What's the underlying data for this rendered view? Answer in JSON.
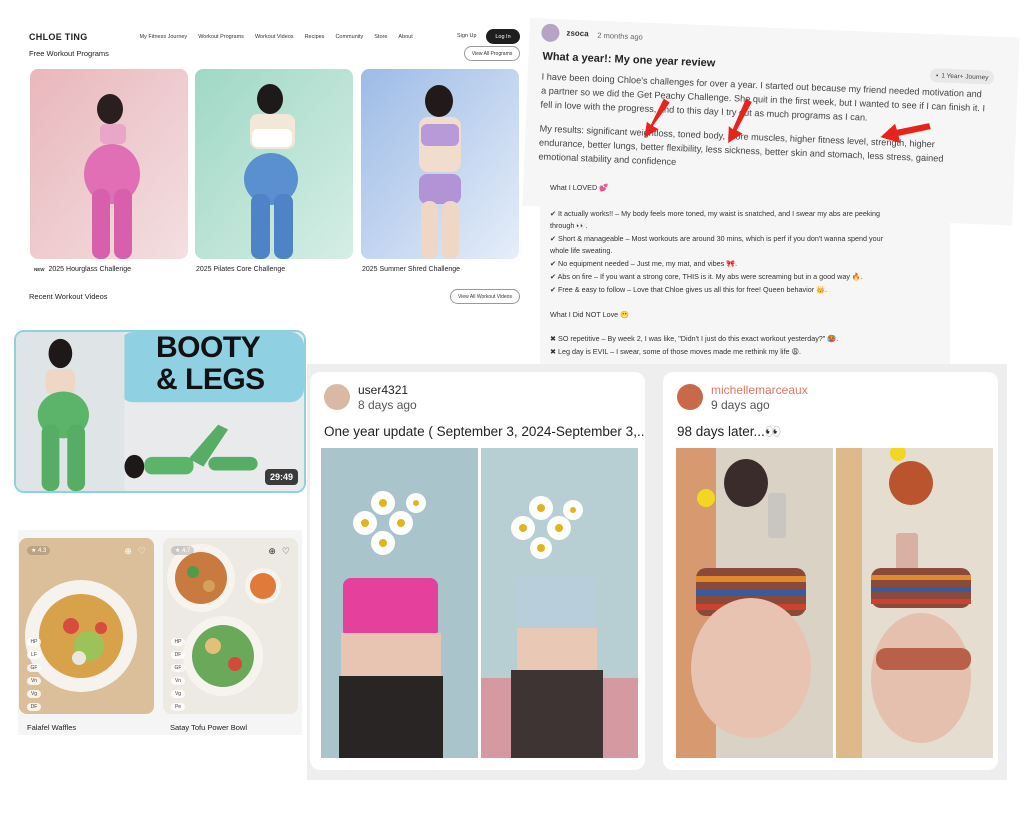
{
  "site": {
    "logo": "CHLOE TING",
    "nav": [
      "My Fitness Journey",
      "Workout Programs",
      "Workout Videos",
      "Recipes",
      "Community",
      "Store",
      "About"
    ],
    "signup": "Sign Up",
    "login": "Log In",
    "programs_title": "Free Workout Programs",
    "programs_button": "View All Programs",
    "programs": [
      {
        "new_tag": "NEW",
        "label": "2025 Hourglass Challenge"
      },
      {
        "new_tag": "",
        "label": "2025 Pilates Core Challenge"
      },
      {
        "new_tag": "",
        "label": "2025 Summer Shred Challenge"
      }
    ],
    "videos_title": "Recent Workout Videos",
    "videos_button": "View All Workout Videos"
  },
  "review": {
    "user": "zsoca",
    "time": "2 months ago",
    "title": "What a year!: My one year review",
    "badge": "1 Year+ Journey",
    "p1": [
      "I have been doing Chloe's challenges for over a year. I started out because my friend needed motivation and",
      "a partner so we did the Get Peachy Challenge. She quit in the first week, but I wanted to see if I can finish it. I",
      "fell in love with the progress, and to this day I try out as much programs as I can."
    ],
    "p2": [
      "My results: significant weightloss, toned body, more muscles, higher fitness level, strength, higher",
      "endurance, better lungs, better flexibility, less sickness, better skin and stomach, less stress, gained",
      "emotional stability and confidence"
    ],
    "loved_title": "What I LOVED 💕",
    "loved": [
      "✔ It actually works!! – My body feels more toned, my waist is snatched, and I swear my abs are peeking",
      "through 👀.",
      "✔ Short & manageable – Most workouts are around 30 mins, which is perf if you don't wanna spend your",
      "whole life sweating.",
      "✔ No equipment needed – Just me, my mat, and vibes 🎀.",
      "✔ Abs on fire – If you want a strong core, THIS is it. My abs were screaming but in a good way 🔥.",
      "✔ Free & easy to follow – Love that Chloe gives us all this for free! Queen behavior 👑."
    ],
    "not_love_title": "What I Did NOT Love 😬",
    "not_love": [
      "✖ SO repetitive – By week 2, I was like, \"Didn't I just do this exact workout yesterday?\" 🥵.",
      "✖ Leg day is EVIL – I swear, some of those moves made me rethink my life 😩."
    ]
  },
  "video": {
    "title_line1": "BOOTY",
    "title_line2": "& LEGS",
    "duration": "29:49"
  },
  "recipes": [
    {
      "rating": "4.3",
      "label": "Falafel Waffles",
      "tags": [
        "HP",
        "LF",
        "GF",
        "Vn",
        "Vg",
        "DF"
      ]
    },
    {
      "rating": "4.7",
      "label": "Satay Tofu Power Bowl",
      "tags": [
        "HP",
        "DF",
        "GF",
        "Vn",
        "Vg",
        "Pe"
      ]
    }
  ],
  "posts": [
    {
      "user": "user4321",
      "time": "8 days ago",
      "title": "One year update ( September 3, 2024-September 3,..."
    },
    {
      "user": "michellemarceaux",
      "time": "9 days ago",
      "title": "98 days later...👀"
    }
  ],
  "colors": {
    "accent_red": "#e8231b",
    "login_bg": "#1e1e1e",
    "video_border": "#8fd0e3",
    "username_highlight": "#e0775f"
  }
}
